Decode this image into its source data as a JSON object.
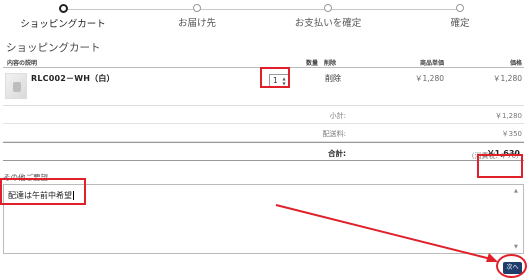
{
  "stepper": {
    "steps": [
      {
        "label": "ショッピングカート",
        "active": true
      },
      {
        "label": "お届け先",
        "active": false
      },
      {
        "label": "お支払いを確定",
        "active": false
      },
      {
        "label": "確定",
        "active": false
      }
    ]
  },
  "page": {
    "title": "ショッピングカート"
  },
  "cart": {
    "headers": {
      "description": "内容の説明",
      "quantity": "数量",
      "delete": "削除",
      "unit_price": "商品単価",
      "price": "価格"
    },
    "item": {
      "name": "RLC002－WH（白）",
      "quantity": "1",
      "delete_label": "削除",
      "unit_price": "￥1,280",
      "price": "￥1,280"
    },
    "subtotal_label": "小計:",
    "subtotal_value": "￥1,280",
    "shipping_label": "配送料:",
    "shipping_value": "￥350",
    "total_label": "合計:",
    "total_value": "￥1,630",
    "tax_note": "（消費税: ￥76）"
  },
  "request": {
    "label": "その他ご要望",
    "value": "配達は午前中希望"
  },
  "next_button": {
    "label": "次へ"
  },
  "annotation_color": "#e0202a"
}
